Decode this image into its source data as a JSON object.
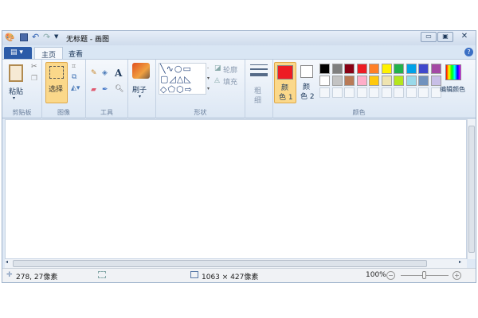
{
  "title": "无标题 - 画图",
  "tabs": {
    "menu": "▤ ▾",
    "home": "主页",
    "view": "查看"
  },
  "clipboard": {
    "paste": "粘贴",
    "group": "剪贴板"
  },
  "image": {
    "select": "选择",
    "group": "图像"
  },
  "tools": {
    "group": "工具",
    "text_tool": "A"
  },
  "brushes": {
    "label": "刷子"
  },
  "shapes": {
    "outline": "轮廓",
    "fill": "填充",
    "group": "形状"
  },
  "size": {
    "label1": "粗",
    "label2": "细"
  },
  "colors": {
    "color1a": "颜",
    "color1b": "色 1",
    "color2a": "颜",
    "color2b": "色 2",
    "edit": "编辑颜色",
    "group": "颜色",
    "row1": [
      "#000000",
      "#7f7f7f",
      "#880015",
      "#ed1c24",
      "#ff7f27",
      "#fff200",
      "#22b14c",
      "#00a2e8",
      "#3f48cc",
      "#a349a4"
    ],
    "row2": [
      "#ffffff",
      "#c3c3c3",
      "#b97a57",
      "#ffaec9",
      "#ffc90e",
      "#efe4b0",
      "#b5e61d",
      "#99d9ea",
      "#7092be",
      "#c8bfe7"
    ],
    "primary": "#ed1c24",
    "secondary": "#ffffff"
  },
  "status": {
    "position": "278, 27像素",
    "canvas_size": "1063 × 427像素",
    "zoom": "100%"
  }
}
